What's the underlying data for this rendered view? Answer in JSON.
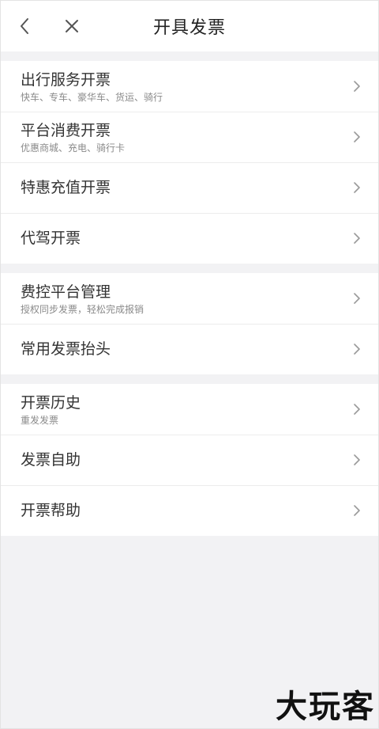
{
  "header": {
    "title": "开具发票",
    "back_icon": "chevron-left-icon",
    "close_icon": "close-icon"
  },
  "groups": [
    {
      "items": [
        {
          "label": "出行服务开票",
          "sub": "快车、专车、豪华车、货运、骑行"
        },
        {
          "label": "平台消费开票",
          "sub": "优惠商城、充电、骑行卡"
        },
        {
          "label": "特惠充值开票",
          "sub": ""
        },
        {
          "label": "代驾开票",
          "sub": ""
        }
      ]
    },
    {
      "items": [
        {
          "label": "费控平台管理",
          "sub": "授权同步发票，轻松完成报销"
        },
        {
          "label": "常用发票抬头",
          "sub": ""
        }
      ]
    },
    {
      "items": [
        {
          "label": "开票历史",
          "sub": "重发发票"
        },
        {
          "label": "发票自助",
          "sub": ""
        },
        {
          "label": "开票帮助",
          "sub": ""
        }
      ]
    }
  ],
  "watermark": "大玩客",
  "colors": {
    "background": "#f2f2f4",
    "card": "#ffffff",
    "text": "#333333",
    "subtext": "#8a8a8a",
    "chevron": "#9a9a9a"
  }
}
